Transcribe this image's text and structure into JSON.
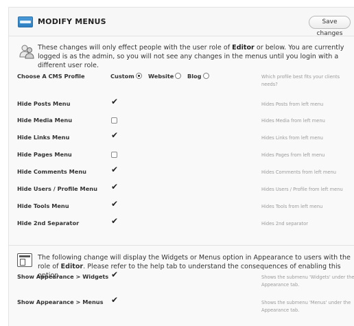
{
  "header": {
    "title": "MODIFY MENUS",
    "icon": "menu-icon",
    "save_label": "Save changes"
  },
  "notice": {
    "icon": "people-icon",
    "text_before": "These changes will only effect people with the user role of ",
    "role": "Editor",
    "text_after": " or below. You are currently logged is as the admin, so you will not see any changes in the menus until you login with a different user role."
  },
  "profile": {
    "label": "Choose A CMS Profile",
    "options": [
      {
        "label": "Custom",
        "selected": true
      },
      {
        "label": "Website",
        "selected": false
      },
      {
        "label": "Blog",
        "selected": false
      }
    ],
    "desc": "Which profile best fits your clients needs?"
  },
  "rows": [
    {
      "label": "Hide Posts Menu",
      "checked": true,
      "desc": "Hides Posts from left menu"
    },
    {
      "label": "Hide Media Menu",
      "checked": false,
      "desc": "Hides Media from left menu"
    },
    {
      "label": "Hide Links Menu",
      "checked": true,
      "desc": "Hides Links from left menu"
    },
    {
      "label": "Hide Pages Menu",
      "checked": false,
      "desc": "Hides Pages from left menu"
    },
    {
      "label": "Hide Comments Menu",
      "checked": true,
      "desc": "Hides Comments from left menu"
    },
    {
      "label": "Hide Users / Profile Menu",
      "checked": true,
      "desc": "Hides Users / Profile from left menu"
    },
    {
      "label": "Hide Tools Menu",
      "checked": true,
      "desc": "Hides Tools from left menu"
    },
    {
      "label": "Hide 2nd Separator",
      "checked": true,
      "desc": "Hides 2nd separator"
    }
  ],
  "notice2": {
    "icon": "window-icon",
    "text_before": "The following change will display the Widgets or Menus option in Appearance to users with the role of ",
    "role": "Editor",
    "text_after": ". Please refer to the help tab to understand the consequences of enabling this option."
  },
  "appearance_rows": [
    {
      "label": "Show Appearance > Widgets",
      "checked": true,
      "desc": "Shows the submenu 'Widgets' under the Appearance tab."
    },
    {
      "label": "Show Appearance > Menus",
      "checked": true,
      "desc": "Shows the submenu 'Menus' under the Appearance tab."
    }
  ],
  "colors": {
    "accent": "#2e7fc1",
    "panel_bg": "#f9f9f9",
    "muted_text": "#9a9a9a"
  }
}
